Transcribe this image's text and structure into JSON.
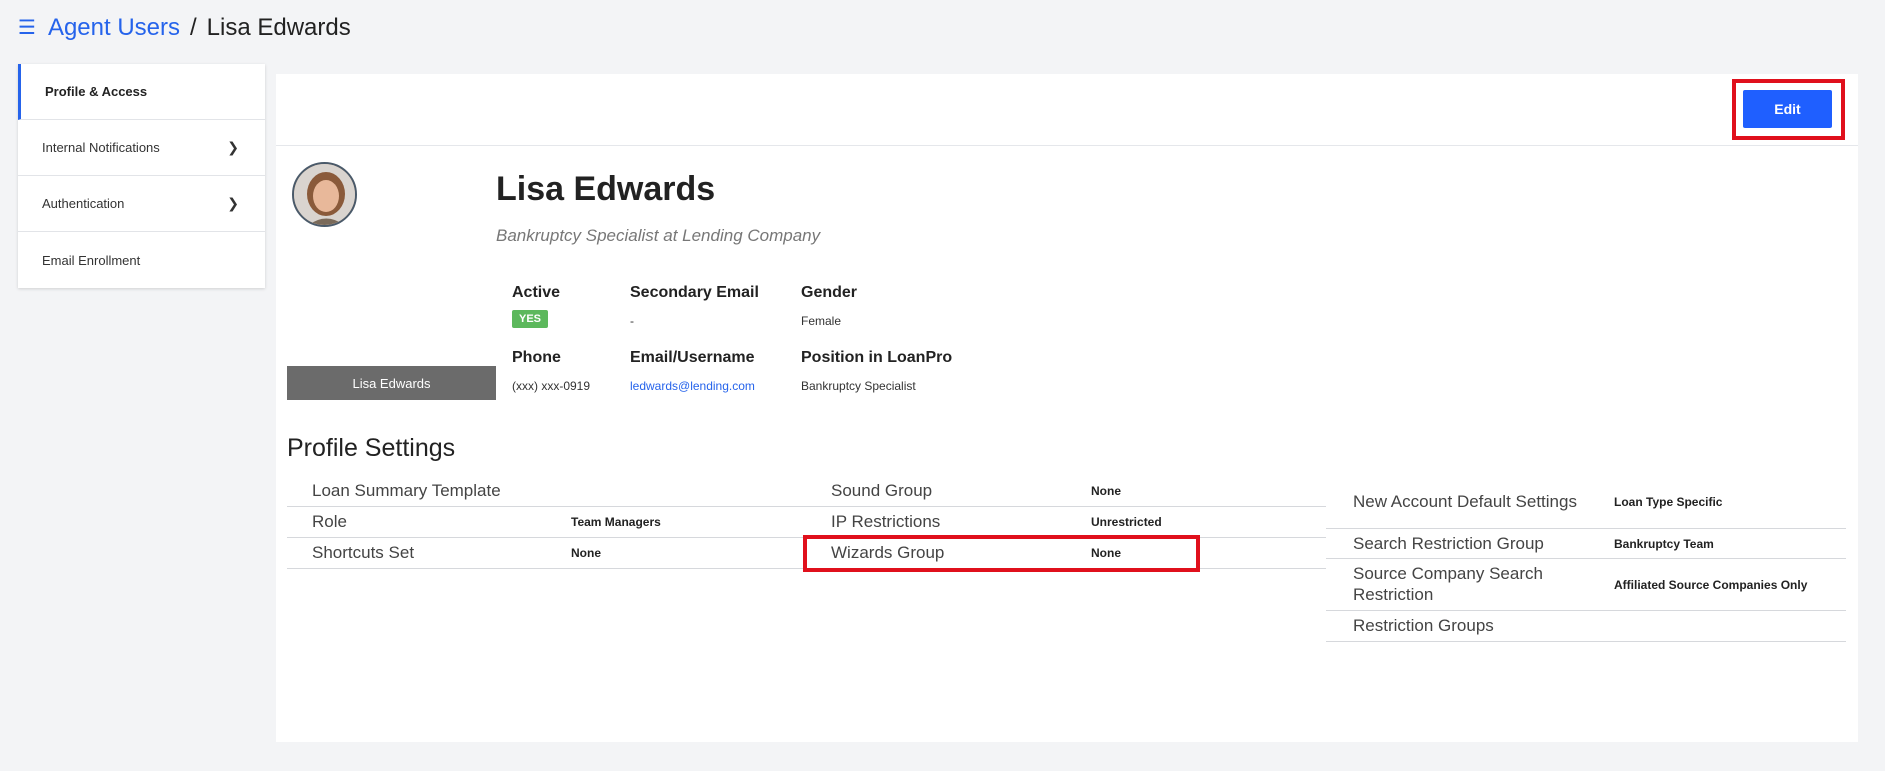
{
  "header": {
    "menu_icon": "hamburger-icon",
    "breadcrumb_parent": "Agent Users",
    "separator": "/",
    "current": "Lisa Edwards"
  },
  "sidebar": {
    "items": [
      {
        "label": "Profile & Access",
        "active": true
      },
      {
        "label": "Internal Notifications",
        "chevron": true
      },
      {
        "label": "Authentication",
        "chevron": true
      },
      {
        "label": "Email Enrollment"
      }
    ]
  },
  "toolbar": {
    "edit_label": "Edit"
  },
  "profile": {
    "name": "Lisa Edwards",
    "title": "Bankruptcy Specialist at Lending Company",
    "name_tag": "Lisa Edwards",
    "fields": {
      "active_label": "Active",
      "active_value": "YES",
      "secondary_email_label": "Secondary Email",
      "secondary_email_value": "-",
      "gender_label": "Gender",
      "gender_value": "Female",
      "phone_label": "Phone",
      "phone_value": "(xxx) xxx-0919",
      "email_label": "Email/Username",
      "email_value": "ledwards@lending.com",
      "position_label": "Position in LoanPro",
      "position_value": "Bankruptcy Specialist"
    }
  },
  "settings": {
    "title": "Profile Settings",
    "col1": [
      {
        "key": "Loan Summary Template",
        "value": ""
      },
      {
        "key": "Role",
        "value": "Team Managers"
      },
      {
        "key": "Shortcuts Set",
        "value": "None"
      }
    ],
    "col2": [
      {
        "key": "Sound Group",
        "value": "None"
      },
      {
        "key": "IP Restrictions",
        "value": "Unrestricted"
      },
      {
        "key": "Wizards Group",
        "value": "None"
      }
    ],
    "col3": [
      {
        "key": "New Account Default Settings",
        "value": "Loan Type Specific"
      },
      {
        "key": "Search Restriction Group",
        "value": "Bankruptcy Team"
      },
      {
        "key": "Source Company Search Restriction",
        "value": "Affiliated Source Companies Only"
      },
      {
        "key": "Restriction Groups",
        "value": ""
      }
    ]
  },
  "colors": {
    "accent": "#2563eb",
    "button": "#1f5fff",
    "highlight": "#e0101c",
    "badge": "#5cb85c"
  }
}
